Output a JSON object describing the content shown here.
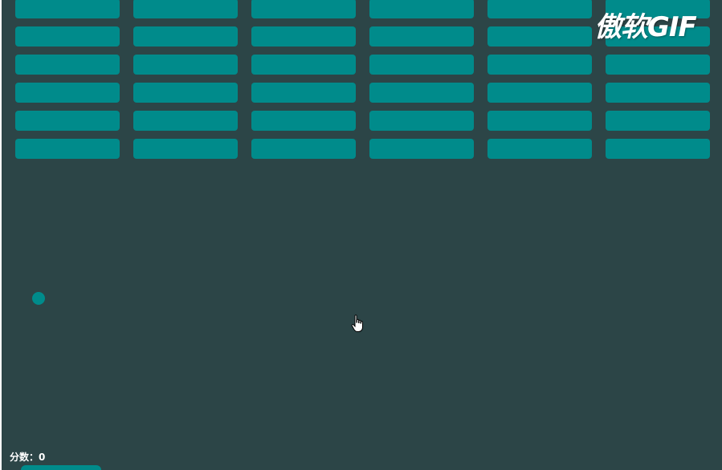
{
  "colors": {
    "background": "#2c4547",
    "brick": "#008b8b",
    "ball": "#008b8b",
    "paddle": "#008b8b"
  },
  "bricks": {
    "rows": 6,
    "columns": 6
  },
  "score": {
    "label": "分数：",
    "value": "0"
  },
  "watermark": {
    "text": "傲软GIF"
  },
  "cursor": {
    "icon": "hand-pointer-icon"
  }
}
